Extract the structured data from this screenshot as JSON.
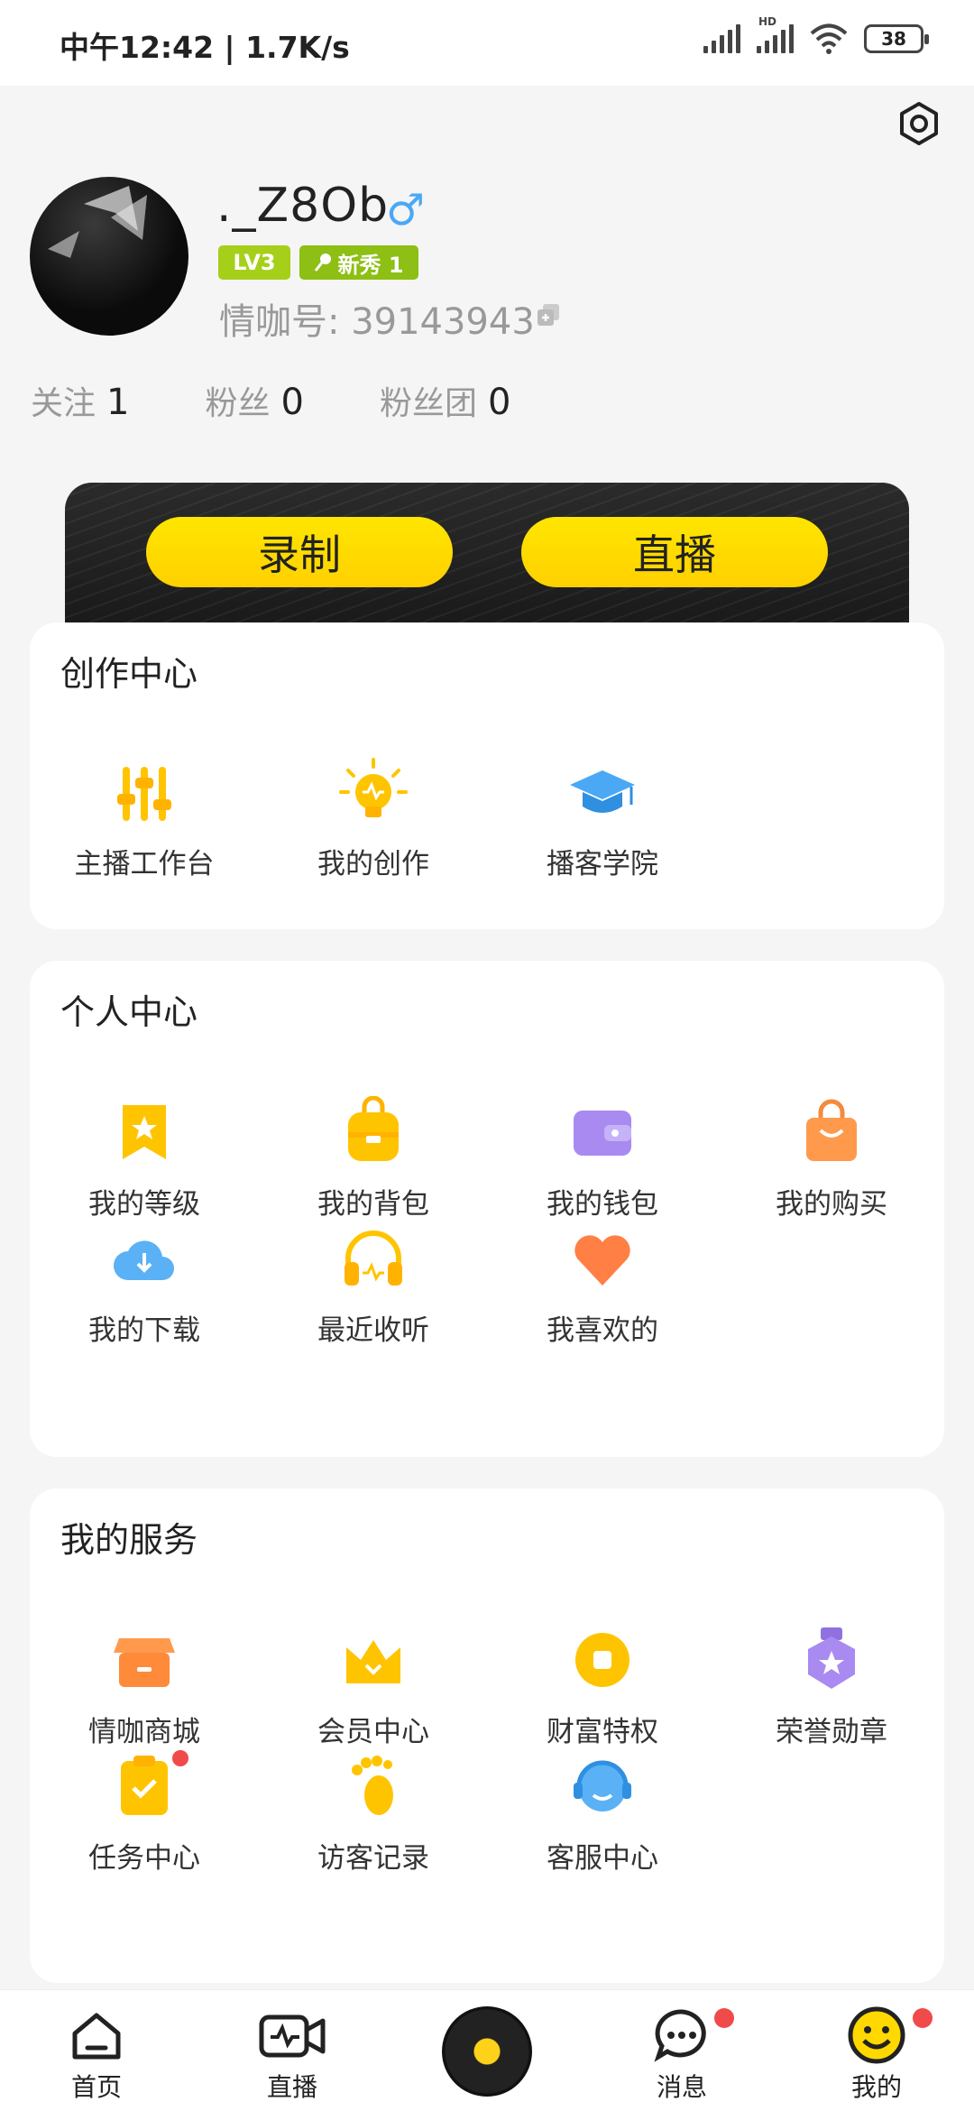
{
  "status_bar": {
    "time": "中午12:42 | 1.7K/s",
    "battery": "38",
    "hd_label": "HD"
  },
  "profile": {
    "username": "._Z8Ob",
    "gender_symbol": "♂",
    "level_badge": "LV3",
    "newbie_badge": "新秀 1",
    "id_label": "情咖号: 39143943"
  },
  "stats": [
    {
      "label": "关注",
      "value": "1"
    },
    {
      "label": "粉丝",
      "value": "0"
    },
    {
      "label": "粉丝团",
      "value": "0"
    }
  ],
  "banner": {
    "record_label": "录制",
    "live_label": "直播"
  },
  "creation_center": {
    "title": "创作中心",
    "items": [
      {
        "label": "主播工作台",
        "icon": "sliders-icon"
      },
      {
        "label": "我的创作",
        "icon": "lightbulb-icon"
      },
      {
        "label": "播客学院",
        "icon": "graduation-cap-icon"
      }
    ]
  },
  "personal_center": {
    "title": "个人中心",
    "items": [
      {
        "label": "我的等级",
        "icon": "level-bookmark-icon"
      },
      {
        "label": "我的背包",
        "icon": "backpack-icon"
      },
      {
        "label": "我的钱包",
        "icon": "wallet-icon"
      },
      {
        "label": "我的购买",
        "icon": "shopping-bag-icon"
      },
      {
        "label": "我的下载",
        "icon": "cloud-download-icon"
      },
      {
        "label": "最近收听",
        "icon": "headphones-icon"
      },
      {
        "label": "我喜欢的",
        "icon": "heart-icon"
      }
    ]
  },
  "services": {
    "title": "我的服务",
    "items": [
      {
        "label": "情咖商城",
        "icon": "store-icon"
      },
      {
        "label": "会员中心",
        "icon": "crown-icon"
      },
      {
        "label": "财富特权",
        "icon": "coin-icon"
      },
      {
        "label": "荣誉勋章",
        "icon": "medal-icon"
      },
      {
        "label": "任务中心",
        "icon": "task-clipboard-icon"
      },
      {
        "label": "访客记录",
        "icon": "footprint-icon"
      },
      {
        "label": "客服中心",
        "icon": "customer-service-icon"
      }
    ]
  },
  "tabbar": {
    "home": "首页",
    "live": "直播",
    "messages": "消息",
    "mine": "我的"
  },
  "colors": {
    "accent_yellow": "#ffd800",
    "notification_red": "#f04a4a",
    "level_green": "#a6cf1a"
  }
}
